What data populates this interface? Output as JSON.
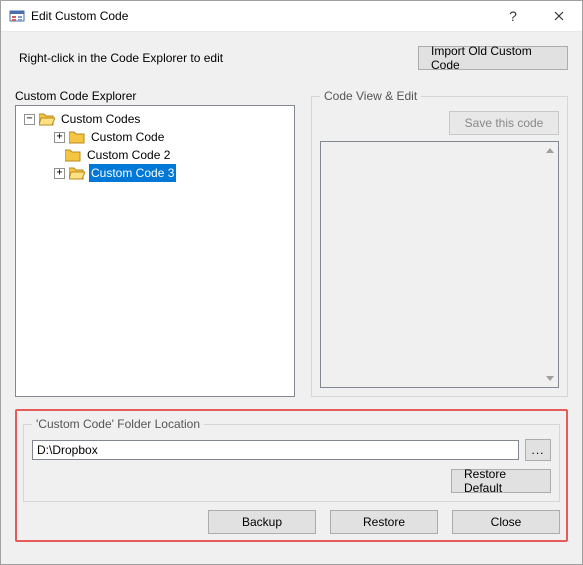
{
  "window": {
    "title": "Edit Custom Code"
  },
  "top": {
    "instruction": "Right-click in the Code Explorer to edit",
    "import_button": "Import Old Custom Code"
  },
  "explorer": {
    "label": "Custom Code Explorer",
    "root": "Custom Codes",
    "items": [
      {
        "label": "Custom Code"
      },
      {
        "label": "Custom Code 2"
      },
      {
        "label": "Custom Code 3"
      }
    ]
  },
  "codeview": {
    "legend": "Code View & Edit",
    "save_button": "Save this code",
    "content": ""
  },
  "folder": {
    "legend": "'Custom Code' Folder Location",
    "path": "D:\\Dropbox",
    "browse": "...",
    "restore": "Restore Default"
  },
  "buttons": {
    "backup": "Backup",
    "restore": "Restore",
    "close": "Close"
  }
}
